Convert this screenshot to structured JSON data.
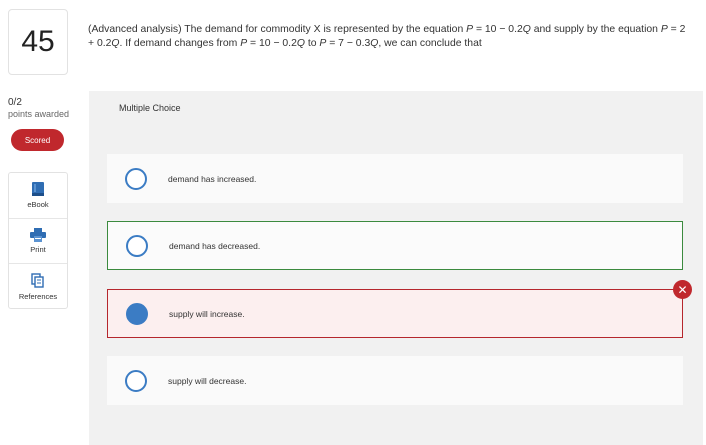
{
  "question": {
    "number": "45",
    "text_parts": [
      "(Advanced analysis) The demand for commodity X is represented by the equation ",
      "P",
      " = 10 − 0.2",
      "Q",
      " and supply by the equation ",
      "P",
      " = 2 + 0.2",
      "Q",
      ". If demand changes from ",
      "P",
      " = 10 − 0.2",
      "Q",
      " to ",
      "P",
      " = 7 − 0.3",
      "Q",
      ", we can conclude that"
    ]
  },
  "score": {
    "value": "0/2",
    "caption": "points awarded"
  },
  "status_badge": "Scored",
  "tools": [
    {
      "label": "eBook",
      "icon": "ebook-icon"
    },
    {
      "label": "Print",
      "icon": "print-icon"
    },
    {
      "label": "References",
      "icon": "references-icon"
    }
  ],
  "panel": {
    "title": "Multiple Choice",
    "options": [
      {
        "label": "demand has increased.",
        "state": "unselected"
      },
      {
        "label": "demand has decreased.",
        "state": "correct"
      },
      {
        "label": "supply will increase.",
        "state": "selected-wrong"
      },
      {
        "label": "supply will decrease.",
        "state": "unselected"
      }
    ]
  },
  "colors": {
    "accent_blue": "#3b7cc4",
    "correct_green": "#3b8a3e",
    "wrong_red": "#b5272d",
    "badge_red": "#c0282d"
  }
}
